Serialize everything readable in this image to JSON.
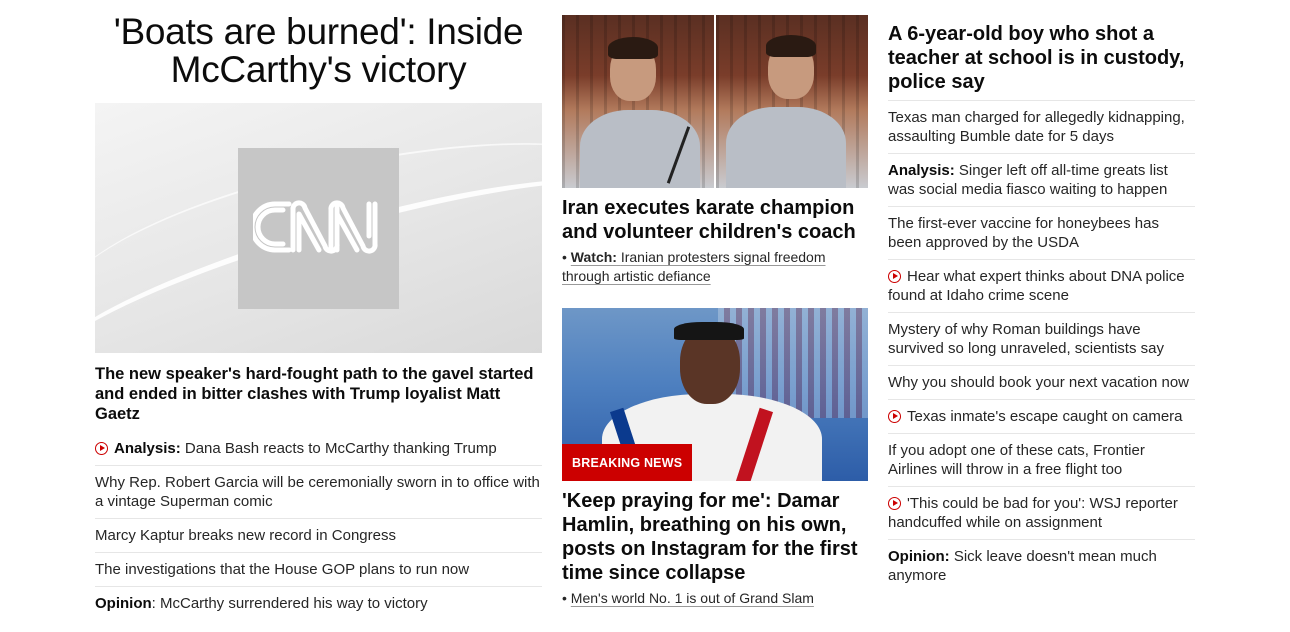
{
  "lead": {
    "title": "'Boats are burned': Inside McCarthy's victory",
    "image_alt": "CNN",
    "description": "The new speaker's hard-fought path to the gavel started and ended in bitter clashes with Trump loyalist Matt Gaetz",
    "related": [
      {
        "kicker": "Analysis:",
        "text": " Dana Bash reacts to McCarthy thanking Trump",
        "icon": "play-icon"
      },
      {
        "kicker": "",
        "text": "Why Rep. Robert Garcia will be ceremonially sworn in to office with a vintage Superman comic",
        "icon": ""
      },
      {
        "kicker": "",
        "text": "Marcy Kaptur breaks new record in Congress",
        "icon": ""
      },
      {
        "kicker": "",
        "text": "The investigations that the House GOP plans to run now",
        "icon": ""
      },
      {
        "kicker": "Opinion",
        "text": ": McCarthy surrendered his way to victory",
        "icon": ""
      }
    ]
  },
  "middle": {
    "story1": {
      "headline": "Iran executes karate champion and volunteer children's coach",
      "watch_kicker": "Watch:",
      "watch_text": "Iranian protesters signal freedom through artistic defiance"
    },
    "story2": {
      "badge": "BREAKING NEWS",
      "headline": "'Keep praying for me': Damar Hamlin, breathing on his own, posts on Instagram for the first time since collapse",
      "sub": "Men's world No. 1 is out of Grand Slam"
    }
  },
  "right": {
    "headline": "A 6-year-old boy who shot a teacher at school is in custody, police say",
    "items": [
      {
        "kicker": "",
        "text": "Texas man charged for allegedly kidnapping, assaulting Bumble date for 5 days",
        "icon": ""
      },
      {
        "kicker": "Analysis:",
        "text": " Singer left off all-time greats list was social media fiasco waiting to happen",
        "icon": ""
      },
      {
        "kicker": "",
        "text": "The first-ever vaccine for honeybees has been approved by the USDA",
        "icon": ""
      },
      {
        "kicker": "",
        "text": "Hear what expert thinks about DNA police found at Idaho crime scene",
        "icon": "play-icon"
      },
      {
        "kicker": "",
        "text": "Mystery of why Roman buildings have survived so long unraveled, scientists say",
        "icon": ""
      },
      {
        "kicker": "",
        "text": "Why you should book your next vacation now",
        "icon": ""
      },
      {
        "kicker": "",
        "text": "Texas inmate's escape caught on camera",
        "icon": "play-icon"
      },
      {
        "kicker": "",
        "text": "If you adopt one of these cats, Frontier Airlines will throw in a free flight too",
        "icon": ""
      },
      {
        "kicker": "",
        "text": "'This could be bad for you': WSJ reporter handcuffed while on assignment",
        "icon": "play-icon"
      },
      {
        "kicker": "Opinion:",
        "text": " Sick leave doesn't mean much anymore",
        "icon": ""
      }
    ]
  },
  "colors": {
    "accent": "#cc0000",
    "text": "#0c0c0c",
    "divider": "#e6e6e6"
  }
}
